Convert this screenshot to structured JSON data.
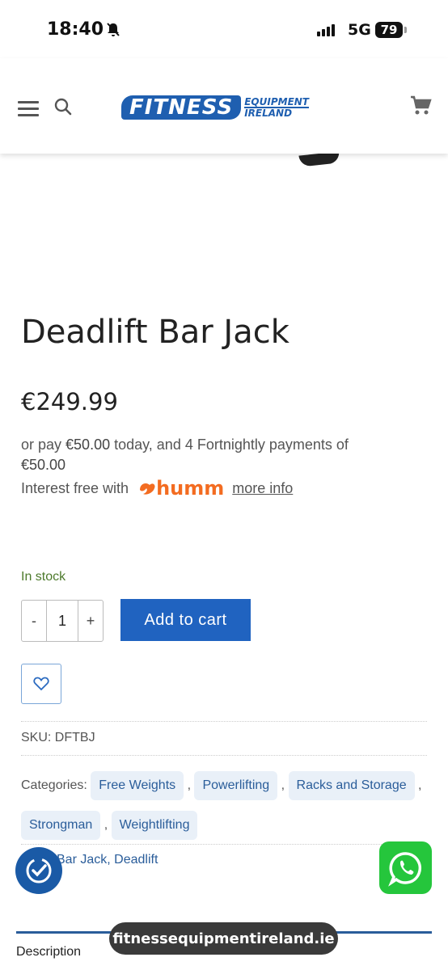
{
  "status_bar": {
    "time": "18:40",
    "network": "5G",
    "battery": "79"
  },
  "header": {
    "logo_main": "FITNESS",
    "logo_sub_1": "EQUIPMENT",
    "logo_sub_2": "IRELAND"
  },
  "product": {
    "title": "Deadlift Bar Jack",
    "price": "€249.99",
    "humm_text_pre": "or pay ",
    "humm_amount_today": "€50.00",
    "humm_text_mid": " today, and 4 Fortnightly payments of ",
    "humm_amount_each": "€50.00",
    "interest_free": "Interest free with",
    "humm_brand": "humm",
    "more_info": "more info",
    "stock": "In stock",
    "qty_minus": "-",
    "qty_value": "1",
    "qty_plus": "+",
    "add_to_cart": "Add to cart",
    "sku": "SKU: DFTBJ",
    "categories_label": "Categories:",
    "categories": [
      "Free Weights",
      "Powerlifting",
      "Racks and Storage",
      "Strongman",
      "Weightlifting"
    ],
    "tags_partial": "Bar Jack",
    "tag_sep": ", ",
    "tag_2": "Deadlift"
  },
  "tabs": {
    "description": "Description"
  },
  "browser": {
    "url": "fitnessequipmentireland.ie"
  },
  "colors": {
    "brand_blue": "#2063c0",
    "stock_green": "#4d7a2c",
    "humm_orange": "#f36c21",
    "whatsapp_green": "#25c63c"
  }
}
